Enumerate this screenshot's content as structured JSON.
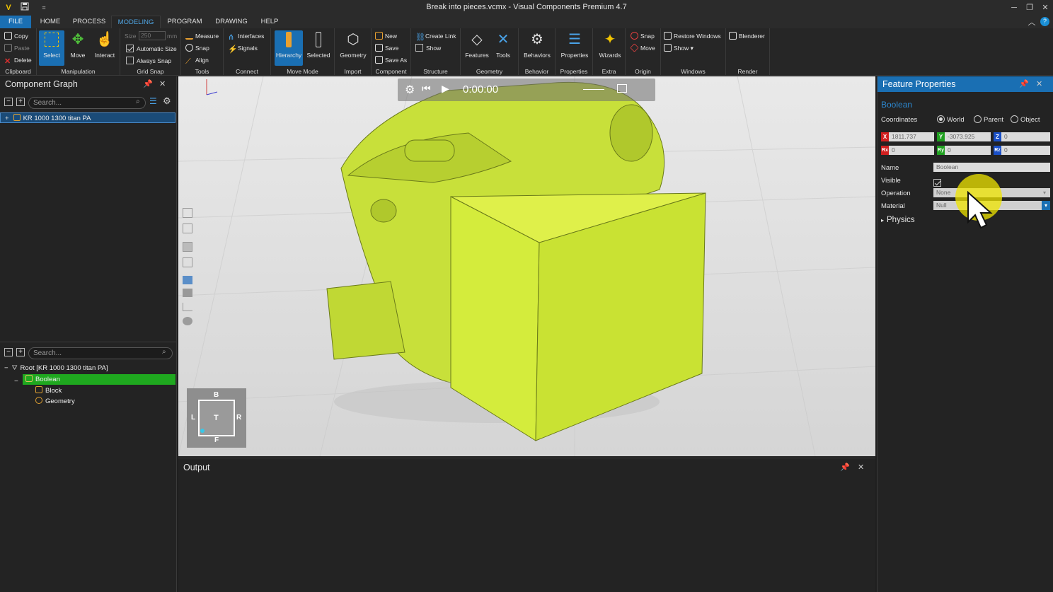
{
  "window": {
    "title": "Break into pieces.vcmx - Visual Components Premium 4.7",
    "app_icon": "V",
    "save_icon": "save-icon",
    "dropdown_glyph": "=",
    "minimize": "─",
    "restore": "❐",
    "close": "✕"
  },
  "menu": {
    "tabs": [
      "FILE",
      "HOME",
      "PROCESS",
      "MODELING",
      "PROGRAM",
      "DRAWING",
      "HELP"
    ],
    "active": "MODELING"
  },
  "ribbon": {
    "clipboard": {
      "label": "Clipboard",
      "copy": "Copy",
      "paste": "Paste",
      "delete": "Delete"
    },
    "manipulation": {
      "label": "Manipulation",
      "select": "Select",
      "move": "Move",
      "interact": "Interact"
    },
    "grid_snap": {
      "label": "Grid Snap",
      "size_label": "Size",
      "size_value": "250",
      "size_unit": "mm",
      "automatic_size": "Automatic Size",
      "always_snap": "Always Snap"
    },
    "tools": {
      "label": "Tools",
      "measure": "Measure",
      "snap": "Snap",
      "align": "Align"
    },
    "connect": {
      "label": "Connect",
      "interfaces": "Interfaces",
      "signals": "Signals"
    },
    "move_mode": {
      "label": "Move Mode",
      "hierarchy": "Hierarchy",
      "selected": "Selected"
    },
    "import": {
      "label": "Import",
      "geometry": "Geometry"
    },
    "component": {
      "label": "Component",
      "new": "New",
      "save": "Save",
      "save_as": "Save As"
    },
    "structure": {
      "label": "Structure",
      "create_link": "Create Link",
      "show": "Show"
    },
    "geometry": {
      "label": "Geometry",
      "features": "Features",
      "tools": "Tools"
    },
    "behavior": {
      "label": "Behavior",
      "behaviors": "Behaviors"
    },
    "properties": {
      "label": "Properties",
      "properties": "Properties"
    },
    "extra": {
      "label": "Extra",
      "wizards": "Wizards"
    },
    "origin": {
      "label": "Origin",
      "snap": "Snap",
      "move": "Move"
    },
    "windows": {
      "label": "Windows",
      "restore_windows": "Restore Windows",
      "show": "Show ▾"
    },
    "render": {
      "label": "Render",
      "blenderer": "Blenderer"
    }
  },
  "component_graph": {
    "title": "Component Graph",
    "search_placeholder": "Search...",
    "items": [
      "KR 1000 1300 titan PA"
    ]
  },
  "hierarchy": {
    "search_placeholder": "Search...",
    "root": "Root [KR 1000 1300 titan PA]",
    "boolean": "Boolean",
    "block": "Block",
    "geometry": "Geometry"
  },
  "viewport": {
    "time": "0:00:00",
    "navcube": {
      "top": "B",
      "left": "L",
      "center": "T",
      "right": "R",
      "bottom": "F"
    },
    "model_color": "#d4ec3c"
  },
  "output": {
    "title": "Output"
  },
  "feature_properties": {
    "title": "Feature Properties",
    "feature_name": "Boolean",
    "coordinates_label": "Coordinates",
    "coord_options": [
      "World",
      "Parent",
      "Object"
    ],
    "coord_selected": "World",
    "x": "1811.737",
    "y": "-3073.925",
    "z": "0",
    "rx": "0",
    "ry": "0",
    "rz": "0",
    "axis_labels": {
      "x": "X",
      "y": "Y",
      "z": "Z",
      "rx": "Rx",
      "ry": "Ry",
      "rz": "Rz"
    },
    "name_label": "Name",
    "name_value": "Boolean",
    "visible_label": "Visible",
    "operation_label": "Operation",
    "operation_value": "None",
    "material_label": "Material",
    "material_value": "Null",
    "physics_label": "Physics"
  }
}
